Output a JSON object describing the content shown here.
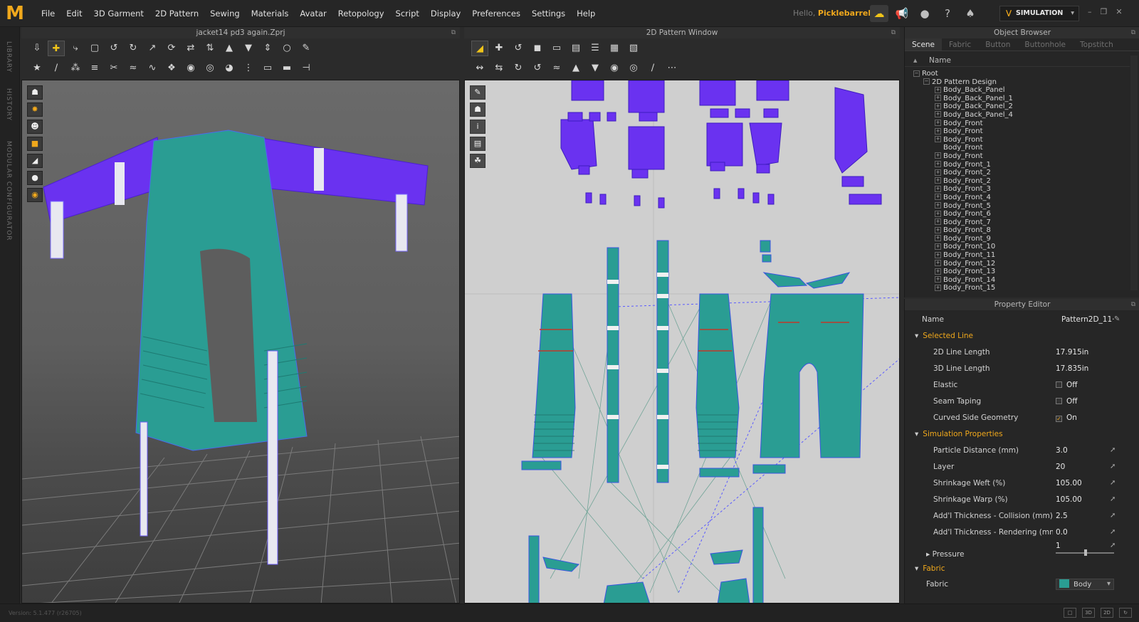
{
  "app": {
    "logo": "M"
  },
  "menu": [
    "File",
    "Edit",
    "3D Garment",
    "2D Pattern",
    "Sewing",
    "Materials",
    "Avatar",
    "Retopology",
    "Script",
    "Display",
    "Preferences",
    "Settings",
    "Help"
  ],
  "user": {
    "greeting": "Hello,",
    "name": "Picklebarrel"
  },
  "top_icons": [
    "cloud-sync-icon",
    "megaphone-icon",
    "user-icon",
    "help-icon",
    "community-icon"
  ],
  "mode": {
    "label": "SIMULATION"
  },
  "side_labels": [
    "LIBRARY",
    "HISTORY",
    "MODULAR CONFIGURATOR"
  ],
  "view3d": {
    "title": "jacket14 pd3 again.Zprj"
  },
  "view2d": {
    "title": "2D Pattern Window"
  },
  "object_browser": {
    "title": "Object Browser",
    "tabs": [
      "Scene",
      "Fabric",
      "Button",
      "Buttonhole",
      "Topstitch"
    ],
    "column": "Name",
    "tree": [
      "Root",
      "2D Pattern Design",
      "Body_Back_Panel",
      "Body_Back_Panel_1",
      "Body_Back_Panel_2",
      "Body_Back_Panel_4",
      "Body_Front",
      "Body_Front",
      "Body_Front",
      "Body_Front",
      "Body_Front",
      "Body_Front_1",
      "Body_Front_2",
      "Body_Front_2",
      "Body_Front_3",
      "Body_Front_4",
      "Body_Front_5",
      "Body_Front_6",
      "Body_Front_7",
      "Body_Front_8",
      "Body_Front_9",
      "Body_Front_10",
      "Body_Front_11",
      "Body_Front_12",
      "Body_Front_13",
      "Body_Front_14",
      "Body_Front_15"
    ]
  },
  "property_editor": {
    "title": "Property Editor",
    "name_label": "Name",
    "name_value": "Pattern2D_11·",
    "selected_line": {
      "title": "Selected Line",
      "rows": [
        {
          "label": "2D Line Length",
          "value": "17.915in"
        },
        {
          "label": "3D Line Length",
          "value": "17.835in"
        },
        {
          "label": "Elastic",
          "value": "Off"
        },
        {
          "label": "Seam Taping",
          "value": "Off"
        },
        {
          "label": "Curved Side Geometry",
          "value": "On"
        }
      ]
    },
    "simulation": {
      "title": "Simulation Properties",
      "rows": [
        {
          "label": "Particle Distance (mm)",
          "value": "3.0"
        },
        {
          "label": "Layer",
          "value": "20"
        },
        {
          "label": "Shrinkage Weft (%)",
          "value": "105.00"
        },
        {
          "label": "Shrinkage Warp (%)",
          "value": "105.00"
        },
        {
          "label": "Add'l Thickness - Collision (mm)",
          "value": "2.5"
        },
        {
          "label": "Add'l Thickness - Rendering (mm)",
          "value": "0.0"
        }
      ],
      "pressure_label": "Pressure",
      "pressure_value": "1"
    },
    "fabric": {
      "title": "Fabric",
      "label": "Fabric",
      "value": "Body"
    }
  },
  "status": {
    "version": "Version: 5.1.477 (r26705)",
    "views": [
      "□",
      "3D",
      "2D",
      "↻"
    ]
  },
  "colors": {
    "accent": "#f0a81c",
    "teal": "#2a9d93",
    "purple": "#7b3ff0"
  }
}
